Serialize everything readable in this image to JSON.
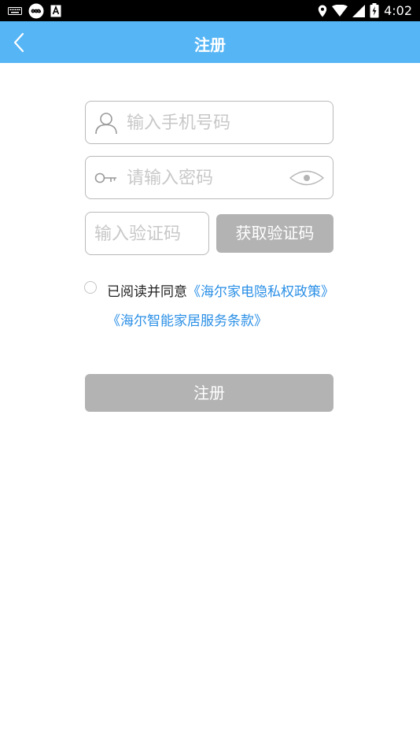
{
  "status_bar": {
    "time": "4:02",
    "left_icons": [
      "keyboard-icon",
      "infinity-app-icon",
      "a-app-icon"
    ],
    "right_icons": [
      "location-icon",
      "wifi-icon",
      "signal-icon",
      "battery-icon"
    ]
  },
  "app_bar": {
    "title": "注册",
    "back_icon": "chevron-left-icon",
    "background": "#56b5f5"
  },
  "form": {
    "phone": {
      "placeholder": "输入手机号码",
      "value": "",
      "icon": "user-icon"
    },
    "password": {
      "placeholder": "请输入密码",
      "value": "",
      "icon": "key-icon",
      "toggle_icon": "eye-icon"
    },
    "code": {
      "placeholder": "输入验证码",
      "value": ""
    },
    "get_code_label": "获取验证码",
    "agreement": {
      "checked": false,
      "prefix": "已阅读并同意",
      "privacy_link": "《海尔家电隐私权政策》",
      "terms_link": "《海尔智能家居服务条款》",
      "link_color": "#2a8fe6"
    },
    "register_label": "注册",
    "disabled_button_color": "#b3b3b3"
  }
}
